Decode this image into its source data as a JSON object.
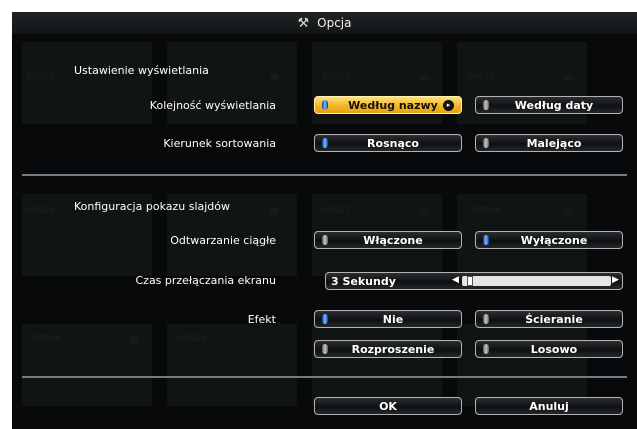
{
  "window": {
    "title": "Opcja",
    "title_icon": "wrench-screwdriver-icon"
  },
  "display_settings": {
    "section_label": "Ustawienie wyświetlania",
    "order": {
      "label": "Kolejność wyświetlania",
      "options": [
        {
          "label": "Według nazwy",
          "selected": true
        },
        {
          "label": "Według daty",
          "selected": false
        }
      ]
    },
    "sort": {
      "label": "Kierunek sortowania",
      "options": [
        {
          "label": "Rosnąco",
          "selected": true
        },
        {
          "label": "Malejąco",
          "selected": false
        }
      ]
    }
  },
  "slideshow": {
    "section_label": "Konfiguracja pokazu slajdów",
    "repeat": {
      "label": "Odtwarzanie ciągłe",
      "options": [
        {
          "label": "Włączone",
          "selected": false
        },
        {
          "label": "Wyłączone",
          "selected": true
        }
      ]
    },
    "switch_time": {
      "label": "Czas przełączania ekranu",
      "value": "3 Sekundy",
      "level": 0.03
    },
    "effect": {
      "label": "Efekt",
      "options": [
        {
          "label": "Nie",
          "selected": true
        },
        {
          "label": "Ścieranie",
          "selected": false
        },
        {
          "label": "Rozproszenie",
          "selected": false
        },
        {
          "label": "Losowo",
          "selected": false
        }
      ]
    }
  },
  "footer": {
    "ok_label": "OK",
    "cancel_label": "Anuluj"
  },
  "background_thumb_labels": [
    "00013",
    "00013",
    "00015",
    "00015",
    "00017",
    "00016",
    "00016",
    "00019"
  ],
  "colors": {
    "active_button": "#f3b626",
    "indicator_on": "#1f6fe0",
    "indicator_off": "#a0a0a0"
  }
}
